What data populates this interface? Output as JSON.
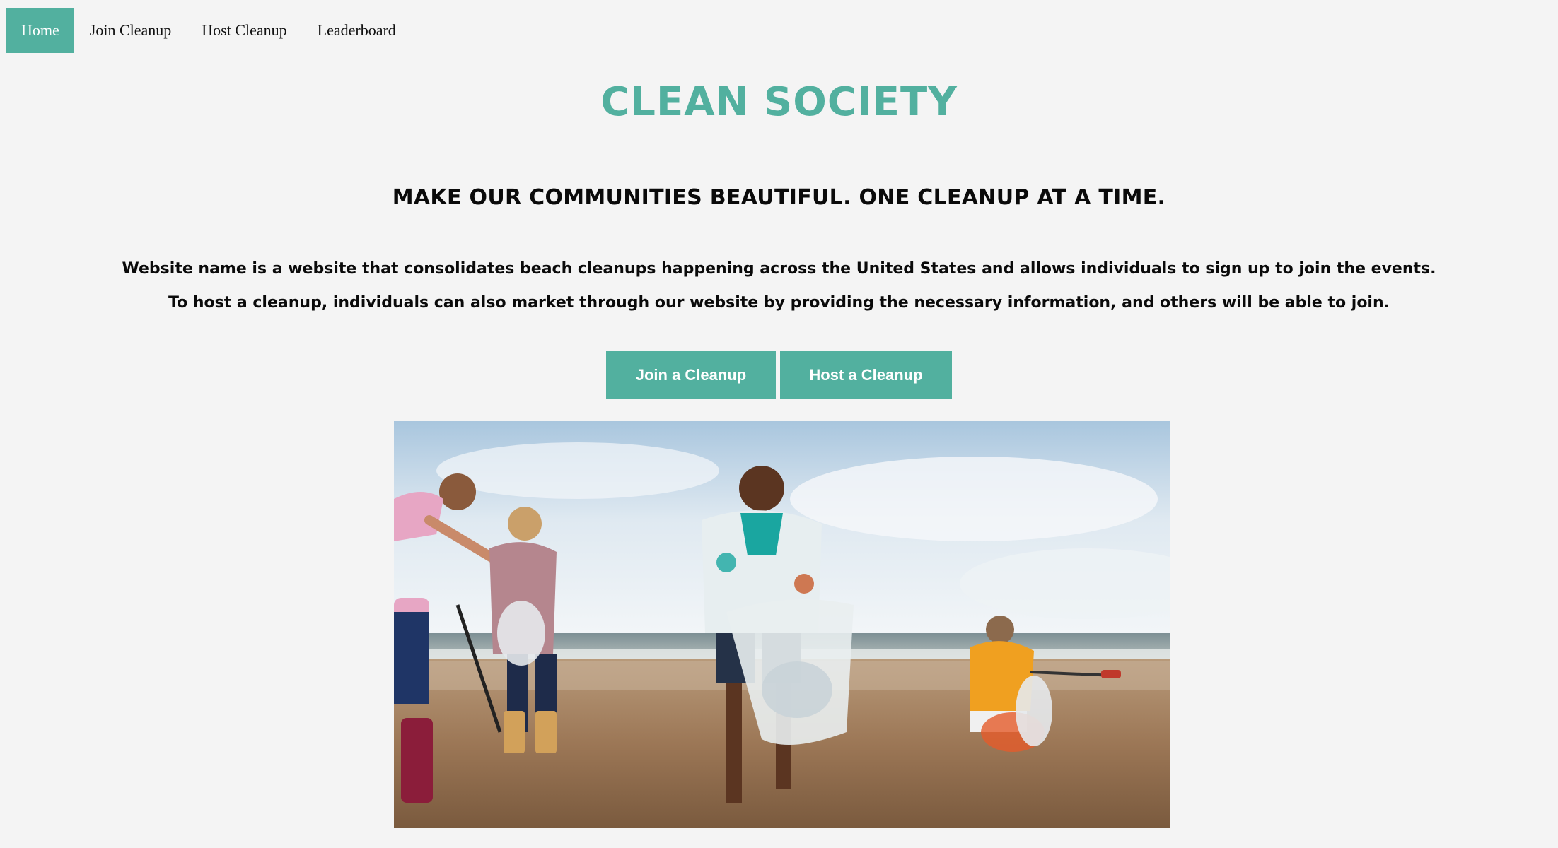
{
  "nav": {
    "items": [
      {
        "label": "Home",
        "active": true
      },
      {
        "label": "Join Cleanup",
        "active": false
      },
      {
        "label": "Host Cleanup",
        "active": false
      },
      {
        "label": "Leaderboard",
        "active": false
      }
    ]
  },
  "hero": {
    "title": "CLEAN SOCIETY",
    "subtitle": "MAKE OUR COMMUNITIES BEAUTIFUL. ONE CLEANUP AT A TIME.",
    "description_line1": "Website name is a website that consolidates beach cleanups happening across the United States and allows individuals to sign up to join the events.",
    "description_line2": "To host a cleanup, individuals can also market through our website by providing the necessary information, and others will be able to join."
  },
  "actions": {
    "join_label": "Join a Cleanup",
    "host_label": "Host a Cleanup"
  },
  "colors": {
    "accent": "#52b09f",
    "background": "#f4f4f4",
    "text": "#0a0a0a"
  }
}
